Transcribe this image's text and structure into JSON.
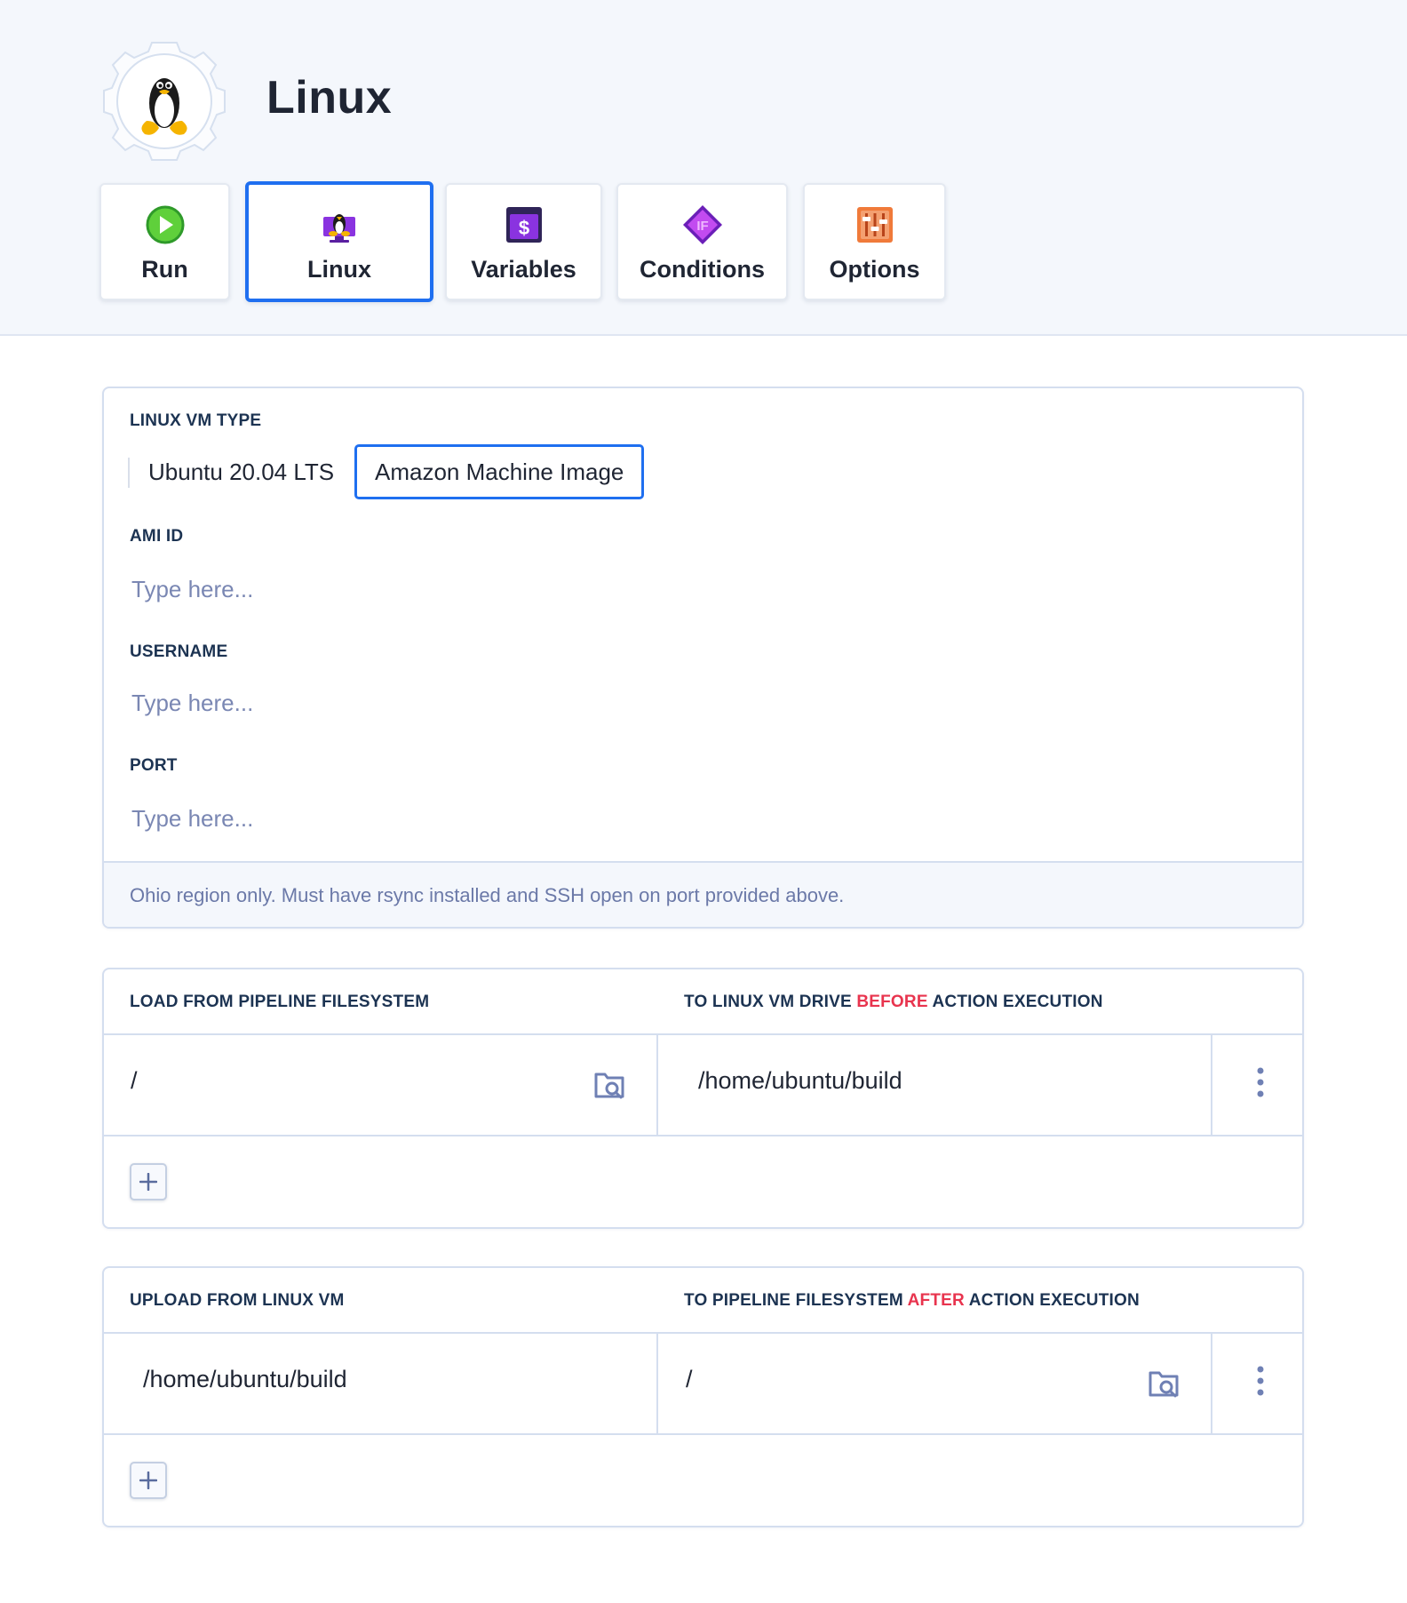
{
  "header": {
    "title": "Linux",
    "app_icon": "linux-gear-icon"
  },
  "tabs": [
    {
      "label": "Run",
      "icon": "play-icon",
      "active": false
    },
    {
      "label": "Linux",
      "icon": "linux-vm-icon",
      "active": true
    },
    {
      "label": "Variables",
      "icon": "variables-icon",
      "active": false
    },
    {
      "label": "Conditions",
      "icon": "conditions-if-icon",
      "active": false
    },
    {
      "label": "Options",
      "icon": "options-sliders-icon",
      "active": false
    }
  ],
  "vm_config": {
    "vm_type_label": "LINUX VM TYPE",
    "vm_type_options": [
      "Ubuntu 20.04 LTS",
      "Amazon Machine Image"
    ],
    "vm_type_selected": "Amazon Machine Image",
    "ami_id": {
      "label": "AMI ID",
      "value": "",
      "placeholder": "Type here..."
    },
    "username": {
      "label": "USERNAME",
      "value": "",
      "placeholder": "Type here..."
    },
    "port": {
      "label": "PORT",
      "value": "",
      "placeholder": "Type here..."
    },
    "note": "Ohio region only. Must have rsync installed and SSH open on port provided above."
  },
  "load_section": {
    "col1_header": "LOAD FROM PIPELINE FILESYSTEM",
    "col2_header_pre": "TO LINUX VM DRIVE ",
    "col2_header_highlight": "BEFORE",
    "col2_header_post": " ACTION EXECUTION",
    "rows": [
      {
        "source": "/",
        "destination": "/home/ubuntu/build"
      }
    ]
  },
  "upload_section": {
    "col1_header": "UPLOAD FROM LINUX VM",
    "col2_header_pre": "TO PIPELINE FILESYSTEM ",
    "col2_header_highlight": "AFTER",
    "col2_header_post": " ACTION EXECUTION",
    "rows": [
      {
        "source": "/home/ubuntu/build",
        "destination": "/"
      }
    ]
  },
  "colors": {
    "accent": "#1f6ff0",
    "highlight": "#e8344e",
    "header_bg": "#f4f7fc",
    "label": "#1c3352",
    "placeholder": "#7a87b3"
  }
}
